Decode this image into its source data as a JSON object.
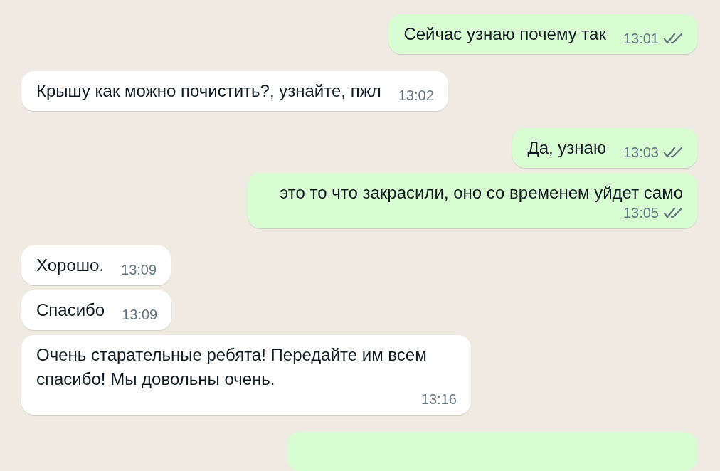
{
  "messages": [
    {
      "outgoing": true,
      "text": "Сейчас узнаю почему так",
      "time": "13:01",
      "read": false
    },
    {
      "outgoing": false,
      "text": "Крышу как можно почистить?, узнайте, пжл",
      "time": "13:02"
    },
    {
      "outgoing": true,
      "text": "Да, узнаю",
      "time": "13:03",
      "read": false
    },
    {
      "outgoing": true,
      "text": "это то что закрасили, оно со временем уйдет само",
      "time": "13:05",
      "read": false
    },
    {
      "outgoing": false,
      "text": "Хорошо.",
      "time": "13:09"
    },
    {
      "outgoing": false,
      "text": "Спасибо",
      "time": "13:09"
    },
    {
      "outgoing": false,
      "text": "Очень старательные ребята! Передайте им всем спасибо! Мы довольны очень.",
      "time": "13:16"
    }
  ],
  "partial_message": {
    "outgoing": true
  }
}
